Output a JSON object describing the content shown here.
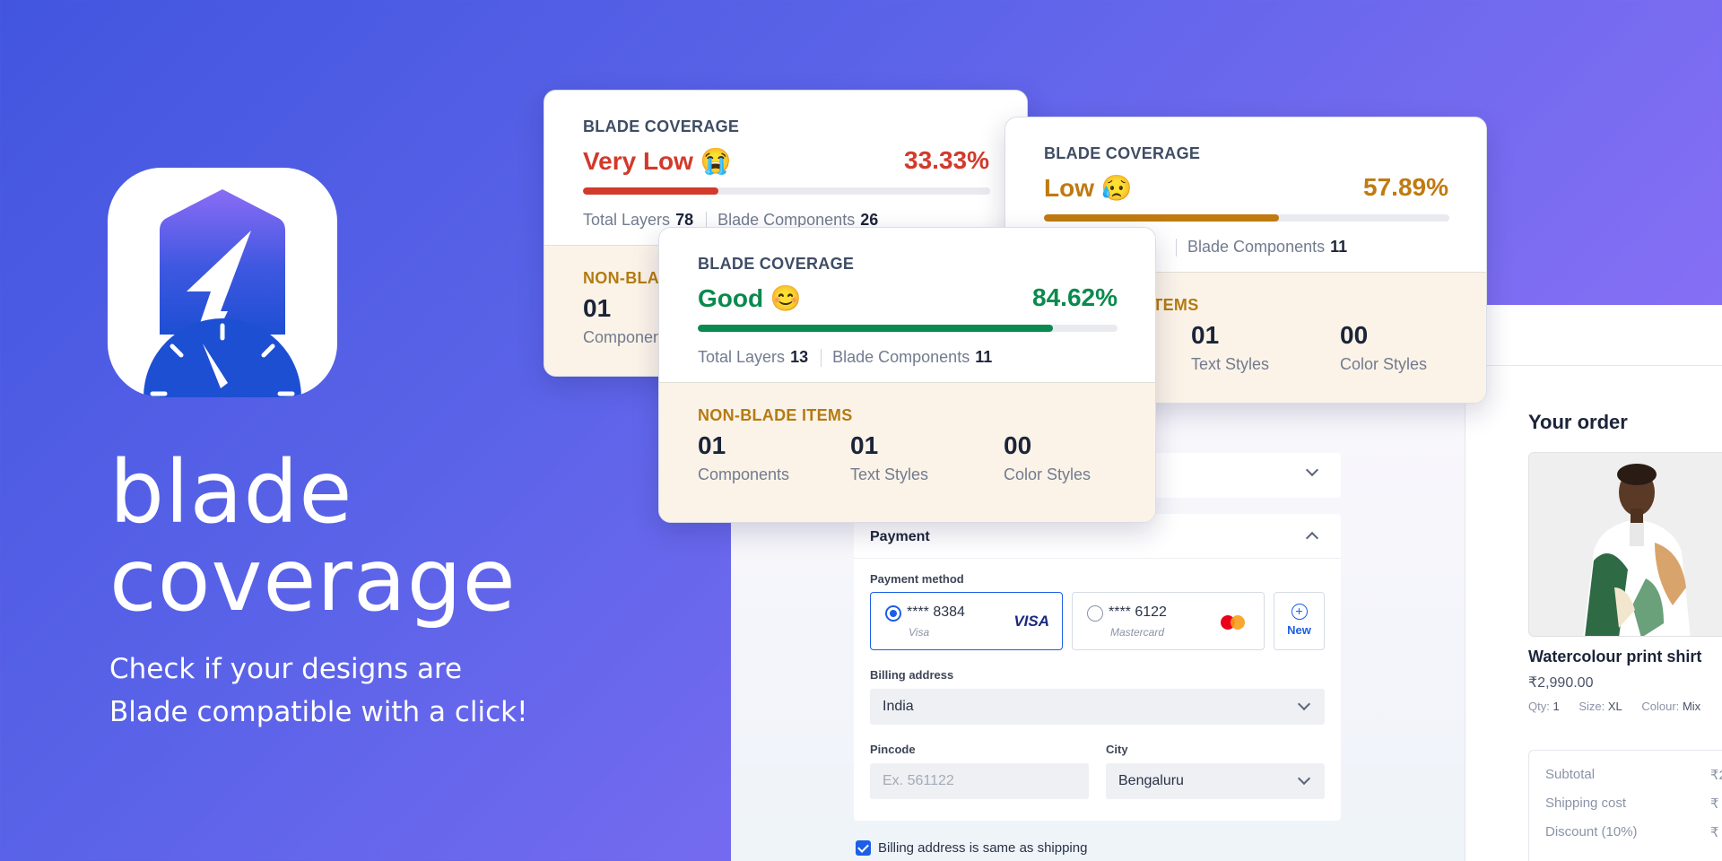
{
  "brand": {
    "title_line1": "blade",
    "title_line2": "coverage",
    "tagline_line1": "Check if your designs are",
    "tagline_line2": "Blade compatible with a click!"
  },
  "colors": {
    "very_low": "#d23a2b",
    "low": "#c07a10",
    "good": "#0a8a4e",
    "accent": "#1c5ee8"
  },
  "cards": {
    "very_low": {
      "heading": "BLADE COVERAGE",
      "status": "Very Low 😭",
      "percent_text": "33.33%",
      "percent_value": 0.3333,
      "total_layers_label": "Total Layers",
      "total_layers": "78",
      "blade_components_label": "Blade Components",
      "blade_components": "26",
      "non_blade_title": "NON-BLADE ITEMS",
      "items": [
        {
          "num": "01",
          "label": "Components"
        }
      ]
    },
    "low": {
      "heading": "BLADE COVERAGE",
      "status": "Low 😥",
      "percent_text": "57.89%",
      "percent_value": 0.5789,
      "blade_components_label": "Blade Components",
      "blade_components": "11",
      "non_blade_title": "NON-BLADE ITEMS",
      "items": [
        {
          "num": "01",
          "label": "Text Styles"
        },
        {
          "num": "00",
          "label": "Color Styles"
        }
      ]
    },
    "good": {
      "heading": "BLADE COVERAGE",
      "status": "Good 😊",
      "percent_text": "84.62%",
      "percent_value": 0.8462,
      "total_layers_label": "Total Layers",
      "total_layers": "13",
      "blade_components_label": "Blade Components",
      "blade_components": "11",
      "non_blade_title": "NON-BLADE ITEMS",
      "items": [
        {
          "num": "01",
          "label": "Components"
        },
        {
          "num": "01",
          "label": "Text Styles"
        },
        {
          "num": "00",
          "label": "Color Styles"
        }
      ]
    }
  },
  "checkout": {
    "payment": {
      "title": "Payment",
      "method_label": "Payment method",
      "cards": [
        {
          "number": "**** 8384",
          "network": "Visa",
          "logo_text": "VISA",
          "selected": true
        },
        {
          "number": "**** 6122",
          "network": "Mastercard",
          "selected": false
        }
      ],
      "new_label": "New",
      "billing_address_label": "Billing address",
      "country": "India",
      "pincode_label": "Pincode",
      "pincode_placeholder": "Ex. 561122",
      "city_label": "City",
      "city": "Bengaluru",
      "same_as_shipping": "Billing address is same as shipping"
    },
    "order": {
      "title": "Your order",
      "product_name": "Watercolour print shirt",
      "price": "₹2,990.00",
      "qty_label": "Qty:",
      "qty": "1",
      "size_label": "Size:",
      "size": "XL",
      "colour_label": "Colour:",
      "colour": "Mix",
      "subtotal_label": "Subtotal",
      "subtotal_partial": "₹2",
      "shipping_label": "Shipping cost",
      "shipping_partial": "₹",
      "discount_label": "Discount (10%)",
      "discount_partial": "₹"
    }
  }
}
